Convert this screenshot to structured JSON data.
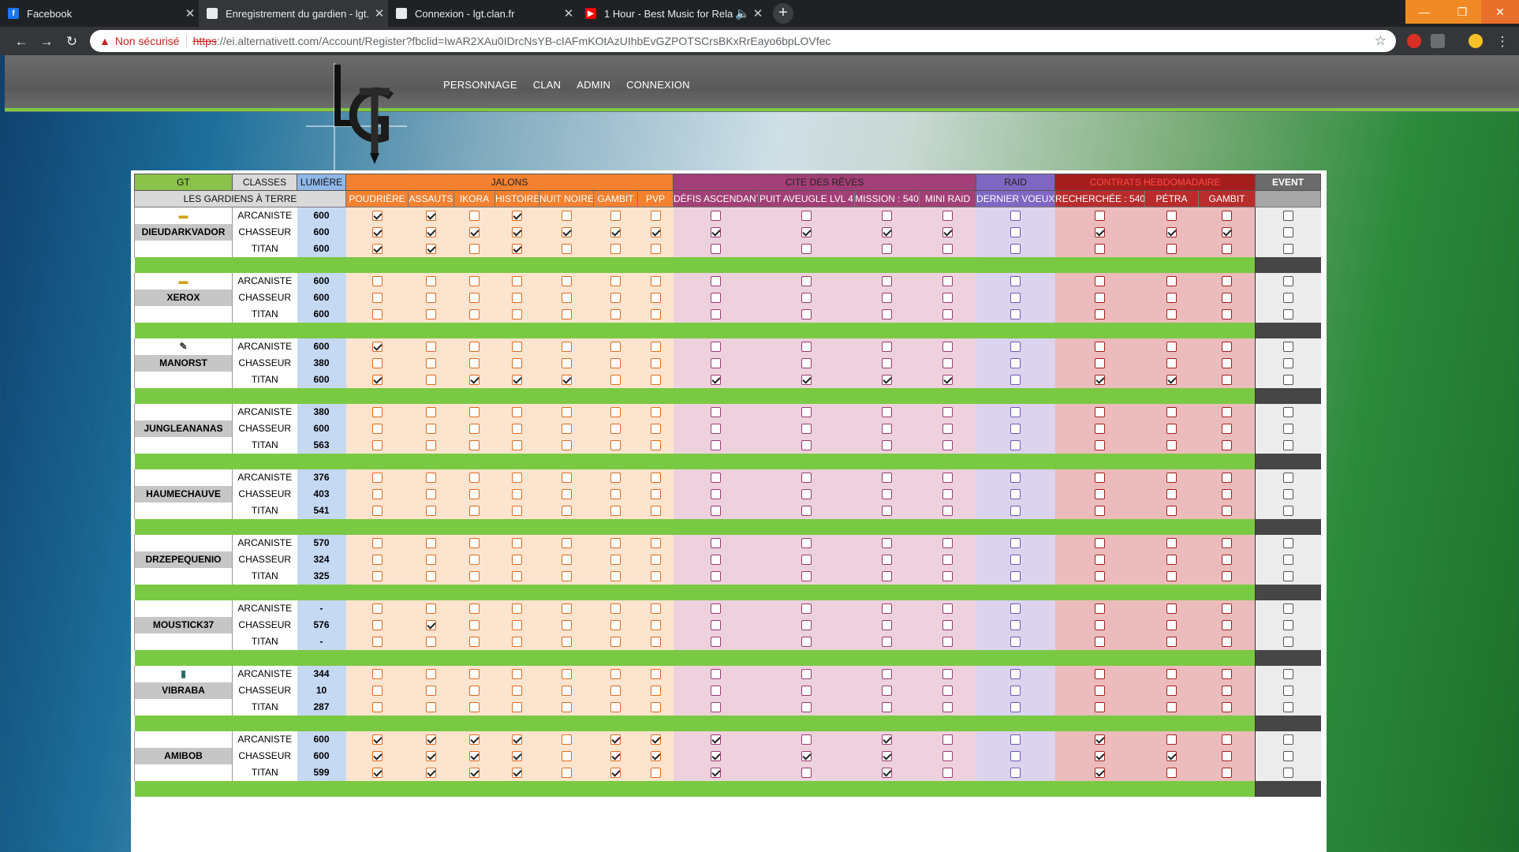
{
  "browser": {
    "tabs": [
      {
        "title": "Facebook",
        "icon": "facebook-icon",
        "active": false
      },
      {
        "title": "Enregistrement du gardien - lgt.",
        "icon": "page-icon",
        "active": true
      },
      {
        "title": "Connexion - lgt.clan.fr",
        "icon": "page-icon",
        "active": false
      },
      {
        "title": "1 Hour - Best Music for Rela",
        "icon": "youtube-icon",
        "active": false
      }
    ],
    "new_tab": "+",
    "security_label": "Non sécurisé",
    "url_scheme": "https",
    "url_rest": "://ei.alternativett.com/Account/Register?fbclid=IwAR2XAu0IDrcNsYB-cIAFmKOtAzUIhbEvGZPOTSCrsBKxRrEayo6bpLOVfec"
  },
  "site": {
    "logo_text": "lGT",
    "nav": [
      "PERSONNAGE",
      "CLAN",
      "ADMIN",
      "CONNEXION"
    ]
  },
  "table": {
    "header1": {
      "gt": "GT",
      "classes": "CLASSES",
      "lumiere": "LUMIÈRE",
      "jalons": "JALONS",
      "cite": "CITE DES RÊVES",
      "raid": "RAID",
      "contrats": "CONTRATS HEBDOMADAIRE",
      "event": "EVENT"
    },
    "header2": {
      "title": "LES GARDIENS À TERRE",
      "jalons": [
        "POUDRIÈRE",
        "ASSAUTS",
        "IKORA",
        "HISTOIRE",
        "NUIT NOIRE",
        "GAMBIT",
        "PVP"
      ],
      "cite": [
        "DÉFIS ASCENDANT",
        "PUIT AVEUGLE LVL 4",
        "MISSION : 540",
        "MINI RAID"
      ],
      "raid": [
        "DERNIER VOEUX"
      ],
      "contrats": [
        "RECHERCHÉE : 540",
        "PÉTRA",
        "GAMBIT"
      ]
    },
    "class_names": [
      "ARCANISTE",
      "CHASSEUR",
      "TITAN"
    ],
    "players": [
      {
        "name": "DIEUDARKVADOR",
        "rank_icon": "rank-badge-icon",
        "levels": [
          "600",
          "600",
          "600"
        ],
        "checks": [
          [
            1,
            1,
            0,
            1,
            0,
            0,
            0,
            0,
            0,
            0,
            0,
            0,
            0,
            0,
            0,
            0
          ],
          [
            1,
            1,
            1,
            1,
            1,
            1,
            1,
            1,
            1,
            1,
            1,
            0,
            1,
            1,
            1,
            0
          ],
          [
            1,
            1,
            0,
            1,
            0,
            0,
            0,
            0,
            0,
            0,
            0,
            0,
            0,
            0,
            0,
            0
          ]
        ]
      },
      {
        "name": "XEROX",
        "rank_icon": "rank-badge-icon",
        "levels": [
          "600",
          "600",
          "600"
        ],
        "checks": [
          [
            0,
            0,
            0,
            0,
            0,
            0,
            0,
            0,
            0,
            0,
            0,
            0,
            0,
            0,
            0,
            0
          ],
          [
            0,
            0,
            0,
            0,
            0,
            0,
            0,
            0,
            0,
            0,
            0,
            0,
            0,
            0,
            0,
            0
          ],
          [
            0,
            0,
            0,
            0,
            0,
            0,
            0,
            0,
            0,
            0,
            0,
            0,
            0,
            0,
            0,
            0
          ]
        ]
      },
      {
        "name": "MANORST",
        "rank_icon": "pen-icon",
        "levels": [
          "600",
          "380",
          "600"
        ],
        "checks": [
          [
            1,
            0,
            0,
            0,
            0,
            0,
            0,
            0,
            0,
            0,
            0,
            0,
            0,
            0,
            0,
            0
          ],
          [
            0,
            0,
            0,
            0,
            0,
            0,
            0,
            0,
            0,
            0,
            0,
            0,
            0,
            0,
            0,
            0
          ],
          [
            1,
            0,
            1,
            1,
            1,
            0,
            0,
            1,
            1,
            1,
            1,
            0,
            1,
            1,
            0,
            0
          ]
        ]
      },
      {
        "name": "JUNGLEANANAS",
        "rank_icon": "",
        "levels": [
          "380",
          "600",
          "563"
        ],
        "checks": [
          [
            0,
            0,
            0,
            0,
            0,
            0,
            0,
            0,
            0,
            0,
            0,
            0,
            0,
            0,
            0,
            0
          ],
          [
            0,
            0,
            0,
            0,
            0,
            0,
            0,
            0,
            0,
            0,
            0,
            0,
            0,
            0,
            0,
            0
          ],
          [
            0,
            0,
            0,
            0,
            0,
            0,
            0,
            0,
            0,
            0,
            0,
            0,
            0,
            0,
            0,
            0
          ]
        ]
      },
      {
        "name": "HAUMECHAUVE",
        "rank_icon": "",
        "levels": [
          "376",
          "403",
          "541"
        ],
        "checks": [
          [
            0,
            0,
            0,
            0,
            0,
            0,
            0,
            0,
            0,
            0,
            0,
            0,
            0,
            0,
            0,
            0
          ],
          [
            0,
            0,
            0,
            0,
            0,
            0,
            0,
            0,
            0,
            0,
            0,
            0,
            0,
            0,
            0,
            0
          ],
          [
            0,
            0,
            0,
            0,
            0,
            0,
            0,
            0,
            0,
            0,
            0,
            0,
            0,
            0,
            0,
            0
          ]
        ]
      },
      {
        "name": "DRZEPEQUENIO",
        "rank_icon": "",
        "levels": [
          "570",
          "324",
          "325"
        ],
        "checks": [
          [
            0,
            0,
            0,
            0,
            0,
            0,
            0,
            0,
            0,
            0,
            0,
            0,
            0,
            0,
            0,
            0
          ],
          [
            0,
            0,
            0,
            0,
            0,
            0,
            0,
            0,
            0,
            0,
            0,
            0,
            0,
            0,
            0,
            0
          ],
          [
            0,
            0,
            0,
            0,
            0,
            0,
            0,
            0,
            0,
            0,
            0,
            0,
            0,
            0,
            0,
            0
          ]
        ]
      },
      {
        "name": "MOUSTICK37",
        "rank_icon": "",
        "levels": [
          "-",
          "576",
          "-"
        ],
        "checks": [
          [
            0,
            0,
            0,
            0,
            0,
            0,
            0,
            0,
            0,
            0,
            0,
            0,
            0,
            0,
            0,
            0
          ],
          [
            0,
            1,
            0,
            0,
            0,
            0,
            0,
            0,
            0,
            0,
            0,
            0,
            0,
            0,
            0,
            0
          ],
          [
            0,
            0,
            0,
            0,
            0,
            0,
            0,
            0,
            0,
            0,
            0,
            0,
            0,
            0,
            0,
            0
          ]
        ]
      },
      {
        "name": "VIBRABA",
        "rank_icon": "door-icon",
        "levels": [
          "344",
          "10",
          "287"
        ],
        "checks": [
          [
            0,
            0,
            0,
            0,
            0,
            0,
            0,
            0,
            0,
            0,
            0,
            0,
            0,
            0,
            0,
            0
          ],
          [
            0,
            0,
            0,
            0,
            0,
            0,
            0,
            0,
            0,
            0,
            0,
            0,
            0,
            0,
            0,
            0
          ],
          [
            0,
            0,
            0,
            0,
            0,
            0,
            0,
            0,
            0,
            0,
            0,
            0,
            0,
            0,
            0,
            0
          ]
        ]
      },
      {
        "name": "AMIBOB",
        "rank_icon": "",
        "levels": [
          "600",
          "600",
          "599"
        ],
        "checks": [
          [
            1,
            1,
            1,
            1,
            0,
            1,
            1,
            1,
            0,
            1,
            0,
            0,
            1,
            0,
            0,
            0
          ],
          [
            1,
            1,
            1,
            1,
            0,
            1,
            1,
            1,
            1,
            1,
            0,
            0,
            1,
            1,
            0,
            0
          ],
          [
            1,
            1,
            1,
            1,
            0,
            1,
            0,
            1,
            0,
            1,
            0,
            0,
            1,
            0,
            0,
            0
          ]
        ]
      }
    ]
  }
}
